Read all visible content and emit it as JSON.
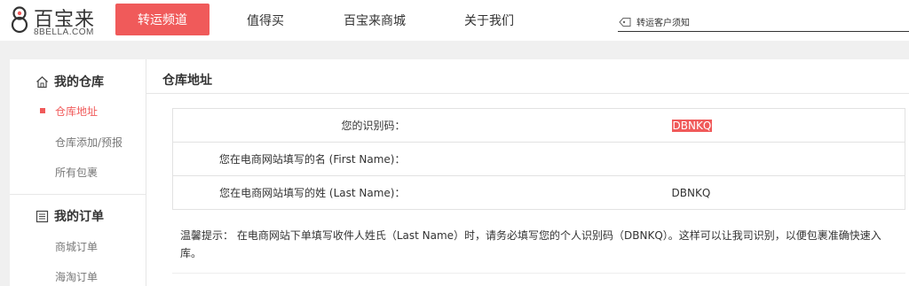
{
  "header": {
    "logo_brand": "百宝来",
    "logo_sub": "8BELLA.COM",
    "nav": [
      {
        "label": "转运频道",
        "active": true
      },
      {
        "label": "值得买"
      },
      {
        "label": "百宝来商城"
      },
      {
        "label": "关于我们"
      }
    ],
    "notice_label": "转运客户须知"
  },
  "sidebar": {
    "sections": [
      {
        "title": "我的仓库",
        "icon": "home-icon",
        "items": [
          {
            "label": "仓库地址",
            "active": true
          },
          {
            "label": "仓库添加/预报"
          },
          {
            "label": "所有包裹"
          }
        ]
      },
      {
        "title": "我的订单",
        "icon": "list-icon",
        "items": [
          {
            "label": "商城订单"
          },
          {
            "label": "海淘订单"
          }
        ]
      }
    ]
  },
  "main": {
    "title": "仓库地址",
    "rows": [
      {
        "label": "您的识别码：",
        "value": "DBNKQ",
        "highlight": true
      },
      {
        "label": "您在电商网站填写的名 (First Name)：",
        "value": ""
      },
      {
        "label": "您在电商网站填写的姓 (Last Name)：",
        "value": "DBNKQ"
      }
    ],
    "tip": "温馨提示： 在电商网站下单填写收件人姓氏（Last Name）时，请务必填写您的个人识别码（DBNKQ）。这样可以让我司识别，以便包裹准确快速入库。"
  },
  "colors": {
    "accent": "#f05a5a"
  }
}
